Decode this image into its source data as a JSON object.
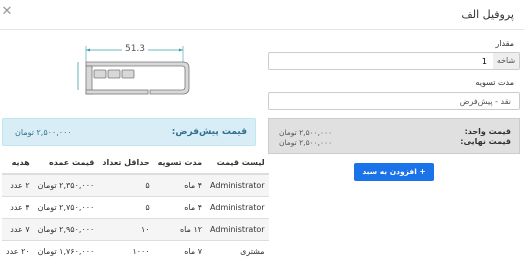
{
  "header": {
    "title": "پروفیل الف"
  },
  "product_image": {
    "dimension_label": "51.3"
  },
  "pre_price": {
    "label": "قیمت پیش‌فرض:",
    "value": "۲,۵۰۰,۰۰۰ تومان"
  },
  "price_table": {
    "columns": [
      "لیست قیمت",
      "مدت تسویه",
      "حداقل تعداد",
      "قیمت عمده",
      "هدیه"
    ],
    "rows": [
      [
        "Administrator",
        "۴ ماه",
        "۵",
        "۲,۳۵۰,۰۰۰ تومان",
        "۲ عدد"
      ],
      [
        "Administrator",
        "۴ ماه",
        "۵",
        "۲,۷۵۰,۰۰۰ تومان",
        "۴ عدد"
      ],
      [
        "Administrator",
        "۱۲ ماه",
        "۱۰",
        "۲,۹۵۰,۰۰۰ تومان",
        "۷ عدد"
      ],
      [
        "مشتری",
        "۷ ماه",
        "۱۰۰۰",
        "۱,۷۶۰,۰۰۰ تومان",
        "۲۰ عدد"
      ]
    ]
  },
  "form": {
    "quantity_label": "مقدار",
    "quantity_value": "1",
    "quantity_unit": "شاخه",
    "term_label": "مدت تسویه",
    "term_value": "نقد - پیش‌فرض"
  },
  "summary": {
    "unit_price_label": "قیمت واحد:",
    "unit_price_value": "۲,۵۰۰,۰۰۰ تومان",
    "final_price_label": "قیمت نهایی:",
    "final_price_value": "۲,۵۰۰,۰۰۰ تومان"
  },
  "actions": {
    "add_to_cart": "+ افزودن به سبد خرید"
  },
  "colors": {
    "accent": "#1a73e8",
    "info_bg": "#d9edf7",
    "info_text": "#31708f"
  }
}
